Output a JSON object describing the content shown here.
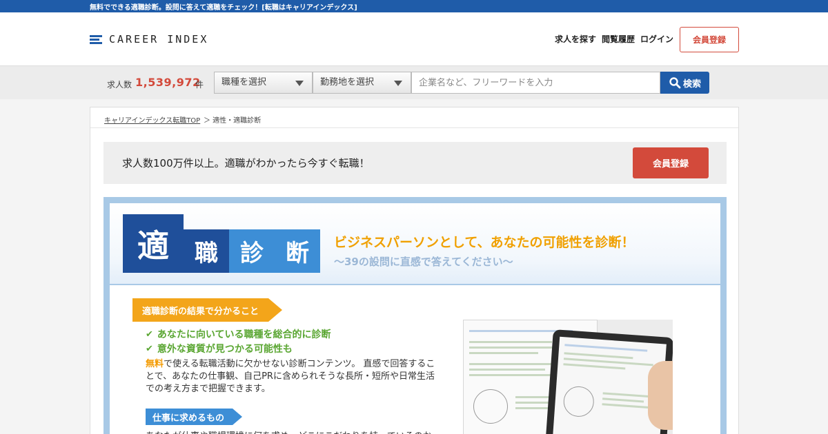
{
  "topbar": {
    "text": "無料でできる適職診断。設問に答えて適職をチェック！[転職はキャリアインデックス]"
  },
  "header": {
    "logo_text": "CAREER INDEX",
    "nav": [
      "求人を探す",
      "閲覧履歴",
      "ログイン"
    ],
    "register_label": "会員登録"
  },
  "search": {
    "count_label": "求人数",
    "count_value": "1,539,972",
    "count_unit": "件",
    "job_type_label": "職種を選択",
    "location_label": "勤務地を選択",
    "keyword_placeholder": "企業名など、フリーワードを入力",
    "button_label": "検索"
  },
  "breadcrumb": {
    "home": "キャリアインデックス転職TOP",
    "current": "＞ 適性・適職診断"
  },
  "banner": {
    "message": "求人数100万件以上。適職がわかったら今すぐ転職！",
    "button_label": "会員登録"
  },
  "diagnosis": {
    "tiles": [
      "適",
      "職",
      "診",
      "断"
    ],
    "headline": "ビジネスパーソンとして、あなたの可能性を診断！",
    "subline": "～39の設問に直感で答えてください～",
    "section1_title": "適職診断の結果で分かること",
    "checks": [
      "あなたに向いている職種を総合的に診断",
      "意外な資質が見つかる可能性も"
    ],
    "check_mark": "✔",
    "desc_free": "無料",
    "desc_rest": "で使える転職活動に欠かせない診断コンテンツ。 直感で回答することで、あなたの仕事観、自己PRに含められそうな長所・短所や日常生活での考え方まで把握できます。",
    "section2_title": "仕事に求めるもの",
    "section2_desc": "あなたが仕事や職場環境に何を求め、どこにこだわりを持っているのか"
  },
  "colors": {
    "brand_blue": "#1f5ca9",
    "accent_red": "#d34a3b",
    "orange": "#f3a51a",
    "green": "#5aa632",
    "tile_dark": "#1f4f9a",
    "tile_light": "#3d8ed6"
  }
}
